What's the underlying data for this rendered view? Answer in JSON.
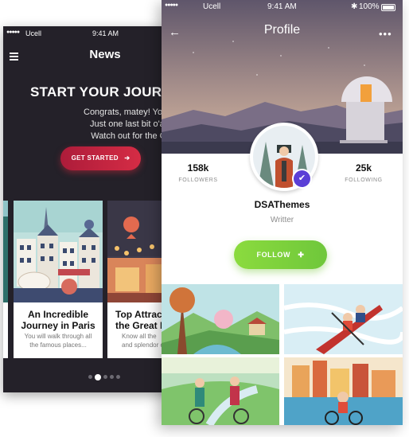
{
  "news": {
    "status": {
      "signal": "●●●●●",
      "carrier": "Ucell",
      "time": "9:41 AM"
    },
    "title": "News",
    "headline": "START YOUR JOURN",
    "body_lines": [
      "Congrats, matey! You're good to g",
      "Just one last bit o'advice. If I m",
      "Watch out for the Ghost Shop!"
    ],
    "cta": "GET STARTED",
    "cards": [
      {
        "title_line1": "An Incredible",
        "title_line2": "Journey in Paris",
        "desc_line1": "You will walk through all",
        "desc_line2": "the famous places..."
      },
      {
        "title_line1": "Top Attrac",
        "title_line2": "the Great L",
        "desc_line1": "Know all the",
        "desc_line2": "and splendor of"
      }
    ],
    "pager": {
      "count": 5,
      "active": 1
    }
  },
  "profile": {
    "status": {
      "signal": "●●●●●",
      "carrier": "Ucell",
      "time": "9:41 AM",
      "bluetooth": "✱",
      "battery": "100%"
    },
    "title": "Profile",
    "followers_count": "158k",
    "followers_label": "FOLLOWERS",
    "following_count": "25k",
    "following_label": "FOLLOWING",
    "name": "DSAThemes",
    "role": "Writter",
    "follow": "FOLLOW"
  },
  "icons": {
    "menu": "hamburger-icon",
    "arrow": "arrow-right-icon",
    "back": "arrow-left-icon",
    "more": "more-horizontal-icon",
    "verify": "check-icon",
    "plus": "plus-icon"
  },
  "colors": {
    "news_bg": "#242129",
    "cta": "#cf2a44",
    "follow": "#7ed23e",
    "verify": "#5a3fd6"
  }
}
